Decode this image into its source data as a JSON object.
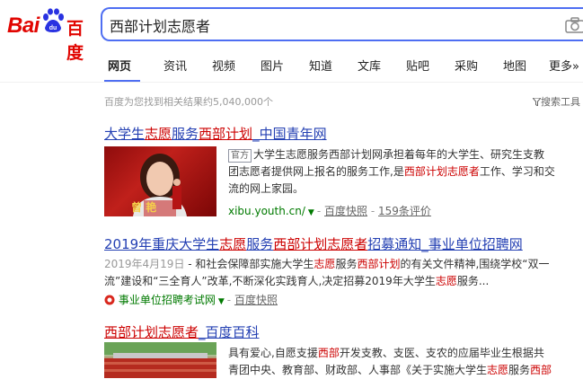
{
  "logo": {
    "brand": "Bai",
    "paw_text": "du",
    "chinese": "百度"
  },
  "search": {
    "query": "西部计划志愿者"
  },
  "tabs": [
    "网页",
    "资讯",
    "视频",
    "图片",
    "知道",
    "文库",
    "贴吧",
    "采购",
    "地图",
    "更多»"
  ],
  "result_count": "百度为您找到相关结果约5,040,000个",
  "tools_label": "搜索工具",
  "results": [
    {
      "title_pre": "大学生",
      "title_em1": "志愿",
      "title_mid": "服务",
      "title_em2": "西部计划",
      "title_post": "_中国青年网",
      "tag": "官方",
      "line1": "大学生志愿服务西部计划网承担着每年的大学生、研究生支教",
      "line2_pre": "团志愿者提供网上报名的服务工作,是",
      "line2_em": "西部计划志愿者",
      "line2_post": "工作、学习和交",
      "line3": "流的网上家园。",
      "source": "xibu.youth.cn/",
      "snapshot": "百度快照",
      "reviews": "159条评价",
      "thumb_caption": "曾 艳"
    },
    {
      "title_pre": "2019年重庆大学生",
      "title_em1": "志愿",
      "title_mid": "服务",
      "title_em2": "西部计划志愿者",
      "title_post": "招募通知_事业单位招聘网",
      "date": "2019年4月19日",
      "line1_pre": " - 和社会保障部实施大学生",
      "line1_em1": "志愿",
      "line1_mid": "服务",
      "line1_em2": "西部计划",
      "line1_post": "的有关文件精神,围绕学校“双一",
      "line2_pre": "流”建设和“三全育人”改革,不断深化实践育人,决定招募2019年大学生",
      "line2_em": "志愿",
      "line2_post": "服务...",
      "source": "事业单位招聘考试网",
      "snapshot": "百度快照"
    },
    {
      "title_em": "西部计划志愿者",
      "title_post": "_百度百科",
      "line1_pre": "具有爱心,自愿支援",
      "line1_em": "西部",
      "line1_post": "开发支教、支医、支农的应届毕业生根据共",
      "line2_pre": "青团中央、教育部、财政部、人事部《关于实施大学生",
      "line2_em": "志愿",
      "line2_mid": "服务",
      "line2_em2": "西部"
    }
  ],
  "colors": {
    "accent": "#4e6ef2",
    "brand_red": "#e10602",
    "link": "#2440b3",
    "highlight": "#c00",
    "source_green": "#007a00"
  }
}
